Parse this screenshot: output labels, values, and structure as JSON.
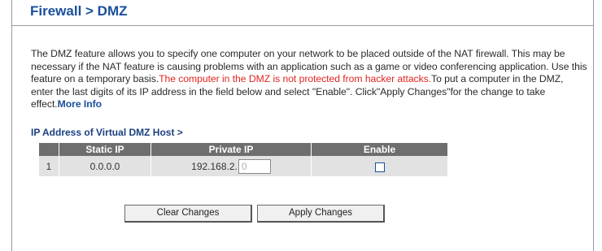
{
  "header": {
    "title": "Firewall > DMZ"
  },
  "description": {
    "text_intro": "The DMZ feature allows you to specify one computer on your network to be placed outside of the NAT firewall. This may be necessary if the NAT feature is causing problems with an application such as a game or video conferencing application. Use this feature on a temporary basis.",
    "warning": "The computer in the DMZ is not protected from hacker attacks.",
    "text_instructions": "To put a computer in the DMZ, enter the last digits of its IP address in the field below and select \"Enable\". Click\"Apply Changes\"for the change to take effect.",
    "more_info_link": "More Info"
  },
  "dmz_table": {
    "section_label": "IP Address of Virtual DMZ Host >",
    "columns": [
      "",
      "Static IP",
      "Private IP",
      "Enable"
    ],
    "rows": [
      {
        "index": "1",
        "static_ip": "0.0.0.0",
        "private_ip_prefix": "192.168.2.",
        "private_ip_last": "",
        "private_ip_placeholder": "0",
        "enabled": false
      }
    ]
  },
  "buttons": {
    "clear": "Clear Changes",
    "apply": "Apply Changes"
  },
  "colors": {
    "title": "#1a4f9a",
    "warning": "#e0261f",
    "link": "#1a4f9a",
    "table_header_bg": "#6e6e6e",
    "table_row_bg": "#e2e2e2"
  }
}
